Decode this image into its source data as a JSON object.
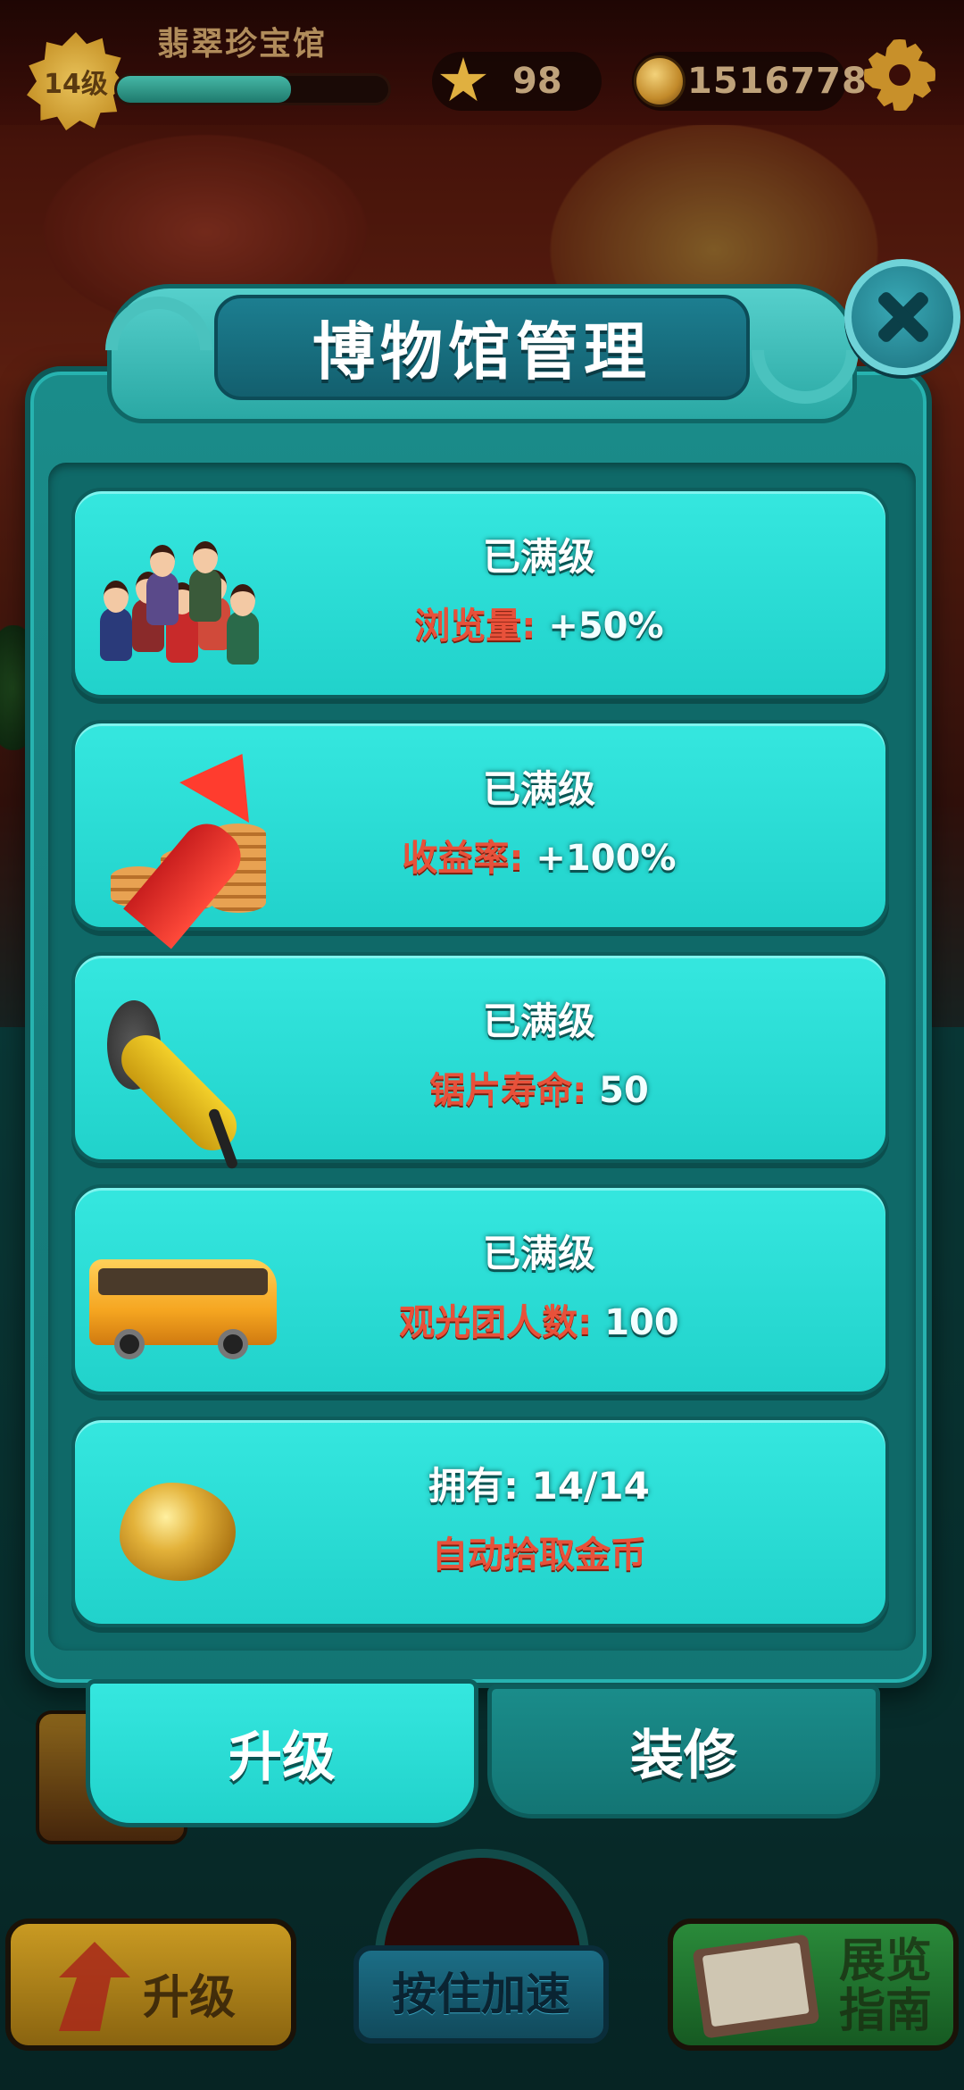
{
  "hud": {
    "level": "14级",
    "museum_name": "翡翠珍宝馆",
    "xp_progress": 0.64,
    "stars": "98",
    "coins": "1516778"
  },
  "panel": {
    "title": "博物馆管理",
    "cards": [
      {
        "status": "已满级",
        "key": "浏览量:",
        "value": " +50%",
        "image": "crowd-icon"
      },
      {
        "status": "已满级",
        "key": "收益率:",
        "value": " +100%",
        "image": "revenue-arrow-icon"
      },
      {
        "status": "已满级",
        "key": "锯片寿命:",
        "value": " 50",
        "image": "angle-grinder-icon"
      },
      {
        "status": "已满级",
        "key": "观光团人数:",
        "value": " 100",
        "image": "tour-bus-icon"
      },
      {
        "status": "拥有: 14/14",
        "key": "自动拾取金币",
        "value": "",
        "image": "gold-toad-icon"
      }
    ],
    "tabs": {
      "upgrade": "升级",
      "decorate": "装修"
    }
  },
  "bottom": {
    "upgrade_label": "升级",
    "speed_label": "按住加速",
    "guide_label": "展览指南"
  },
  "colors": {
    "card_teal": "#21d2cb",
    "panel_teal": "#137574",
    "key_red": "#e8513a"
  }
}
